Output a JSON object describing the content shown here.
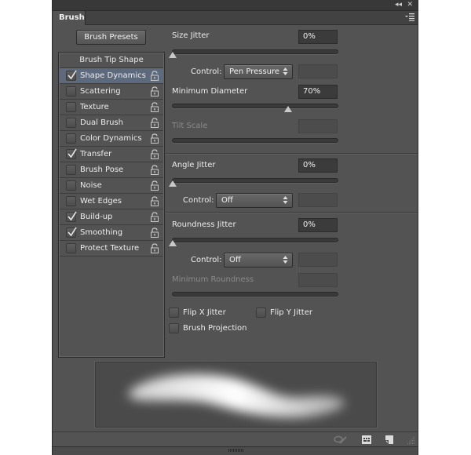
{
  "panel": {
    "tab_label": "Brush",
    "window_controls": {
      "collapse": "◂◂",
      "close": "✕"
    },
    "menu_icon": "panel-menu-icon"
  },
  "sidebar": {
    "presets_button": "Brush Presets",
    "header": "Brush Tip Shape",
    "items": [
      {
        "label": "Shape Dynamics",
        "checked": true,
        "selected": true
      },
      {
        "label": "Scattering",
        "checked": false,
        "selected": false
      },
      {
        "label": "Texture",
        "checked": false,
        "selected": false
      },
      {
        "label": "Dual Brush",
        "checked": false,
        "selected": false
      },
      {
        "label": "Color Dynamics",
        "checked": false,
        "selected": false
      },
      {
        "label": "Transfer",
        "checked": true,
        "selected": false
      },
      {
        "label": "Brush Pose",
        "checked": false,
        "selected": false
      },
      {
        "label": "Noise",
        "checked": false,
        "selected": false
      },
      {
        "label": "Wet Edges",
        "checked": false,
        "selected": false
      },
      {
        "label": "Build-up",
        "checked": true,
        "selected": false
      },
      {
        "label": "Smoothing",
        "checked": true,
        "selected": false
      },
      {
        "label": "Protect Texture",
        "checked": false,
        "selected": false
      }
    ]
  },
  "settings": {
    "size_jitter": {
      "label": "Size Jitter",
      "value": "0%",
      "slider_percent": 0
    },
    "size_control": {
      "label": "Control:",
      "value": "Pen Pressure"
    },
    "minimum_diameter": {
      "label": "Minimum Diameter",
      "value": "70%",
      "slider_percent": 70
    },
    "tilt_scale": {
      "label": "Tilt Scale",
      "value": "",
      "enabled": false
    },
    "angle_jitter": {
      "label": "Angle Jitter",
      "value": "0%",
      "slider_percent": 0
    },
    "angle_control": {
      "label": "Control:",
      "value": "Off"
    },
    "roundness_jitter": {
      "label": "Roundness Jitter",
      "value": "0%",
      "slider_percent": 0
    },
    "roundness_control": {
      "label": "Control:",
      "value": "Off"
    },
    "minimum_roundness": {
      "label": "Minimum Roundness",
      "value": "",
      "enabled": false
    },
    "flip_x": {
      "label": "Flip X Jitter",
      "checked": false
    },
    "flip_y": {
      "label": "Flip Y Jitter",
      "checked": false
    },
    "brush_projection": {
      "label": "Brush Projection",
      "checked": false
    }
  },
  "footer": {
    "icons": [
      "toggle-live-tip-preview-icon",
      "open-preset-manager-icon",
      "create-new-brush-icon"
    ]
  }
}
